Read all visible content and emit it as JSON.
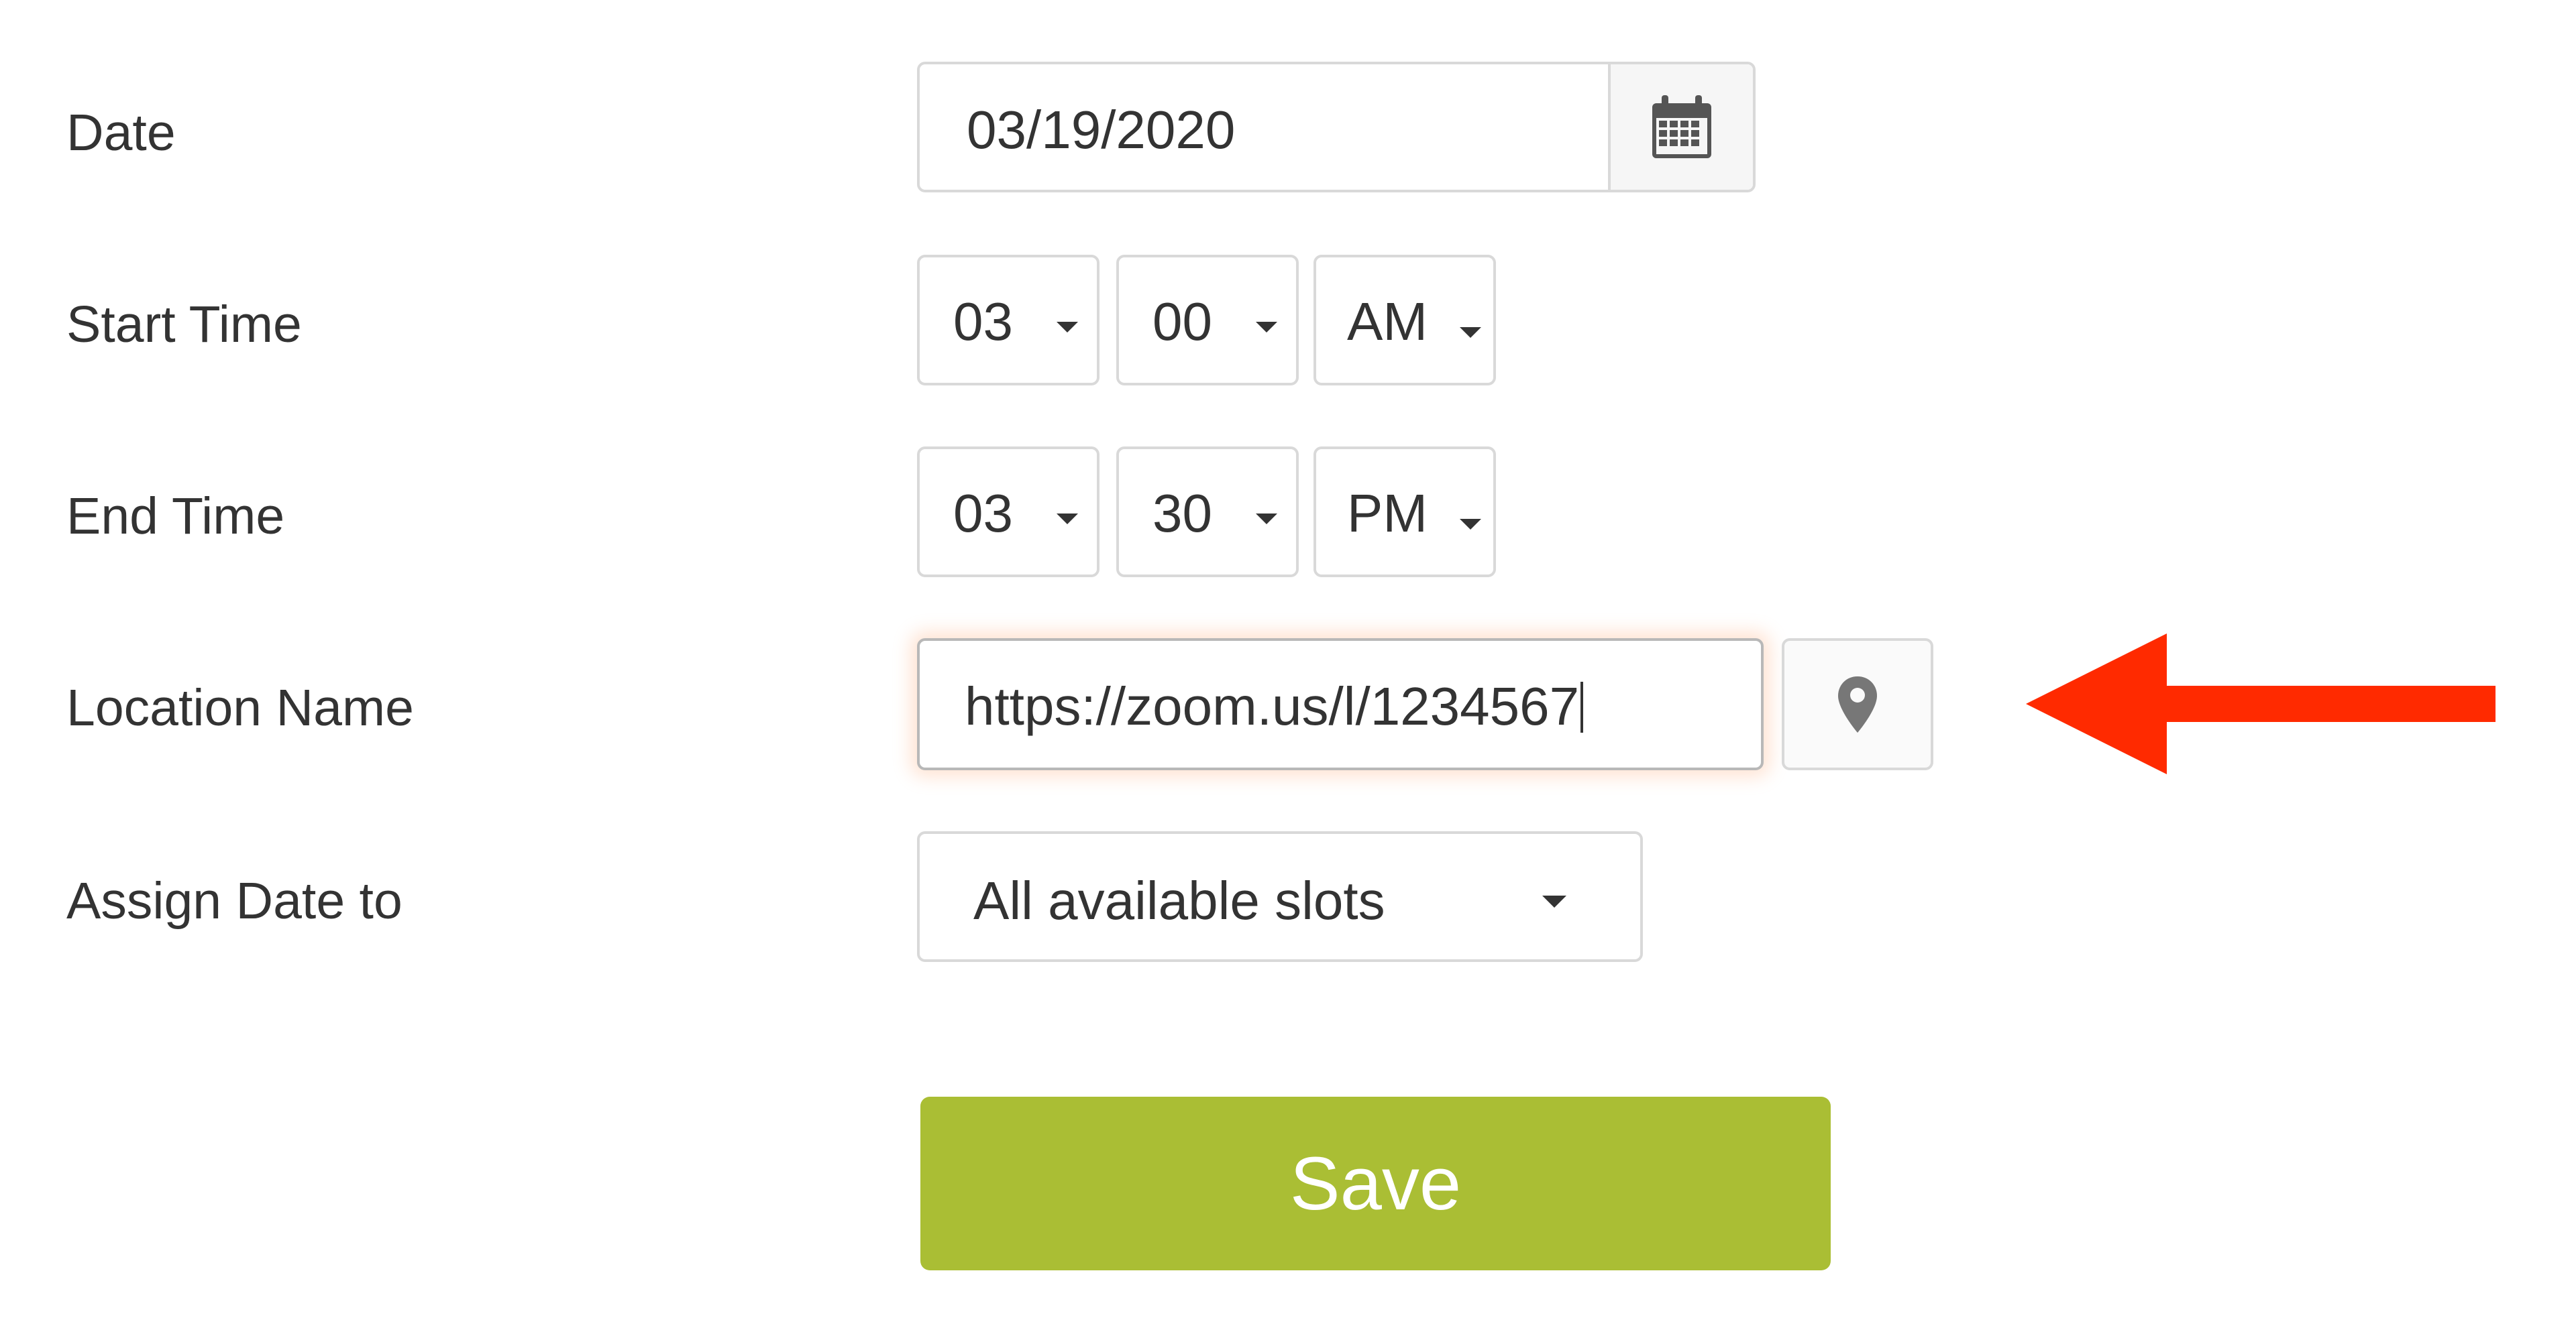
{
  "form": {
    "date": {
      "label": "Date",
      "value": "03/19/2020",
      "calendar_icon": "calendar-icon"
    },
    "start_time": {
      "label": "Start Time",
      "hour": "03",
      "minute": "00",
      "ampm": "AM"
    },
    "end_time": {
      "label": "End Time",
      "hour": "03",
      "minute": "30",
      "ampm": "PM"
    },
    "location": {
      "label": "Location Name",
      "value": "https://zoom.us/l/1234567",
      "pin_icon": "map-pin-icon"
    },
    "assign": {
      "label": "Assign Date to",
      "value": "All available slots"
    },
    "save_label": "Save"
  },
  "annotation": {
    "arrow_icon": "left-arrow-icon",
    "arrow_color": "#ff2a00"
  },
  "colors": {
    "save_button": "#aabe34",
    "text": "#333333",
    "border": "#d9d9d9"
  }
}
